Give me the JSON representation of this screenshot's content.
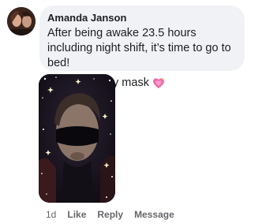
{
  "comment": {
    "author": "Amanda Janson",
    "text_line1": "After being awake 23.5 hours including night shift, it’s time to go to bed!",
    "text_line2": "I loveeeee my mask",
    "emoji": "sparkling-heart-icon",
    "photo": "selfie-with-sleep-mask",
    "footer": {
      "time": "1d",
      "like": "Like",
      "reply": "Reply",
      "message": "Message"
    }
  },
  "colors": {
    "bubble": "#f0f2f5",
    "text": "#1c1e21",
    "meta": "#65676b",
    "heart": "#f06bab"
  }
}
